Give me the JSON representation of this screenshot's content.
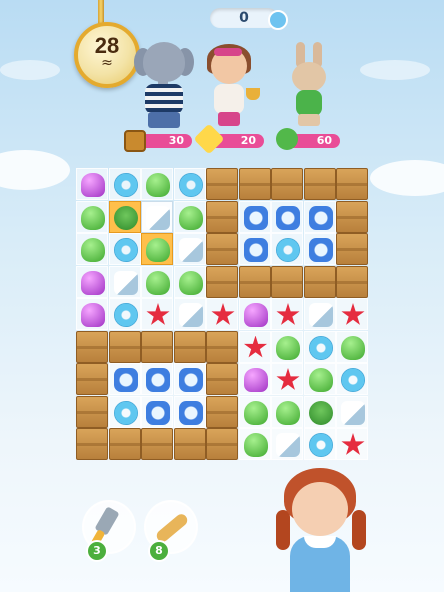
{
  "hud": {
    "score": "0",
    "moves_left": "28"
  },
  "goals": [
    {
      "name": "honey-crate",
      "icon": "honey-jar-icon",
      "label": "Honey",
      "count": "30"
    },
    {
      "name": "butterfly",
      "icon": "butterfly-icon",
      "count": "20"
    },
    {
      "name": "green-leaf",
      "icon": "leaf-candy-icon",
      "count": "60"
    }
  ],
  "characters": [
    "elephant-sailor",
    "girl-with-cup",
    "green-bunny"
  ],
  "boosters": [
    {
      "name": "spatula",
      "icon": "spatula-icon",
      "count": "3"
    },
    {
      "name": "rolling-pin",
      "icon": "rolling-pin-icon",
      "count": "8"
    }
  ],
  "board": {
    "cols": 9,
    "rows": 9,
    "grid": [
      [
        "jelly",
        "donut",
        "leaf",
        "donut",
        "crate",
        "crate",
        "crate",
        "crate",
        "crate"
      ],
      [
        "leaf",
        "orange-frog",
        "ice-pop",
        "leaf",
        "crate",
        "bow",
        "bow",
        "bow",
        "crate"
      ],
      [
        "leaf",
        "donut",
        "orange-leaf",
        "pop",
        "crate",
        "bow",
        "donut",
        "bow",
        "crate"
      ],
      [
        "jelly",
        "pop",
        "leaf",
        "leaf",
        "crate",
        "crate",
        "crate",
        "crate",
        "crate"
      ],
      [
        "jelly",
        "donut",
        "star",
        "pop",
        "star",
        "jelly",
        "star",
        "pop",
        "star"
      ],
      [
        "crate",
        "crate",
        "crate",
        "crate",
        "crate",
        "star",
        "leaf",
        "donut",
        "leaf"
      ],
      [
        "crate",
        "bow",
        "bow",
        "bow",
        "crate",
        "jelly",
        "star",
        "leaf",
        "donut"
      ],
      [
        "crate",
        "donut",
        "bow",
        "bow",
        "crate",
        "leaf",
        "leaf",
        "frog",
        "pop"
      ],
      [
        "crate",
        "crate",
        "crate",
        "crate",
        "crate",
        "leaf",
        "pop",
        "donut",
        "star"
      ]
    ]
  },
  "colors": {
    "goal_bar": "#e94d97",
    "crate": "#c8904a",
    "booster_count": "#4caf3d"
  }
}
